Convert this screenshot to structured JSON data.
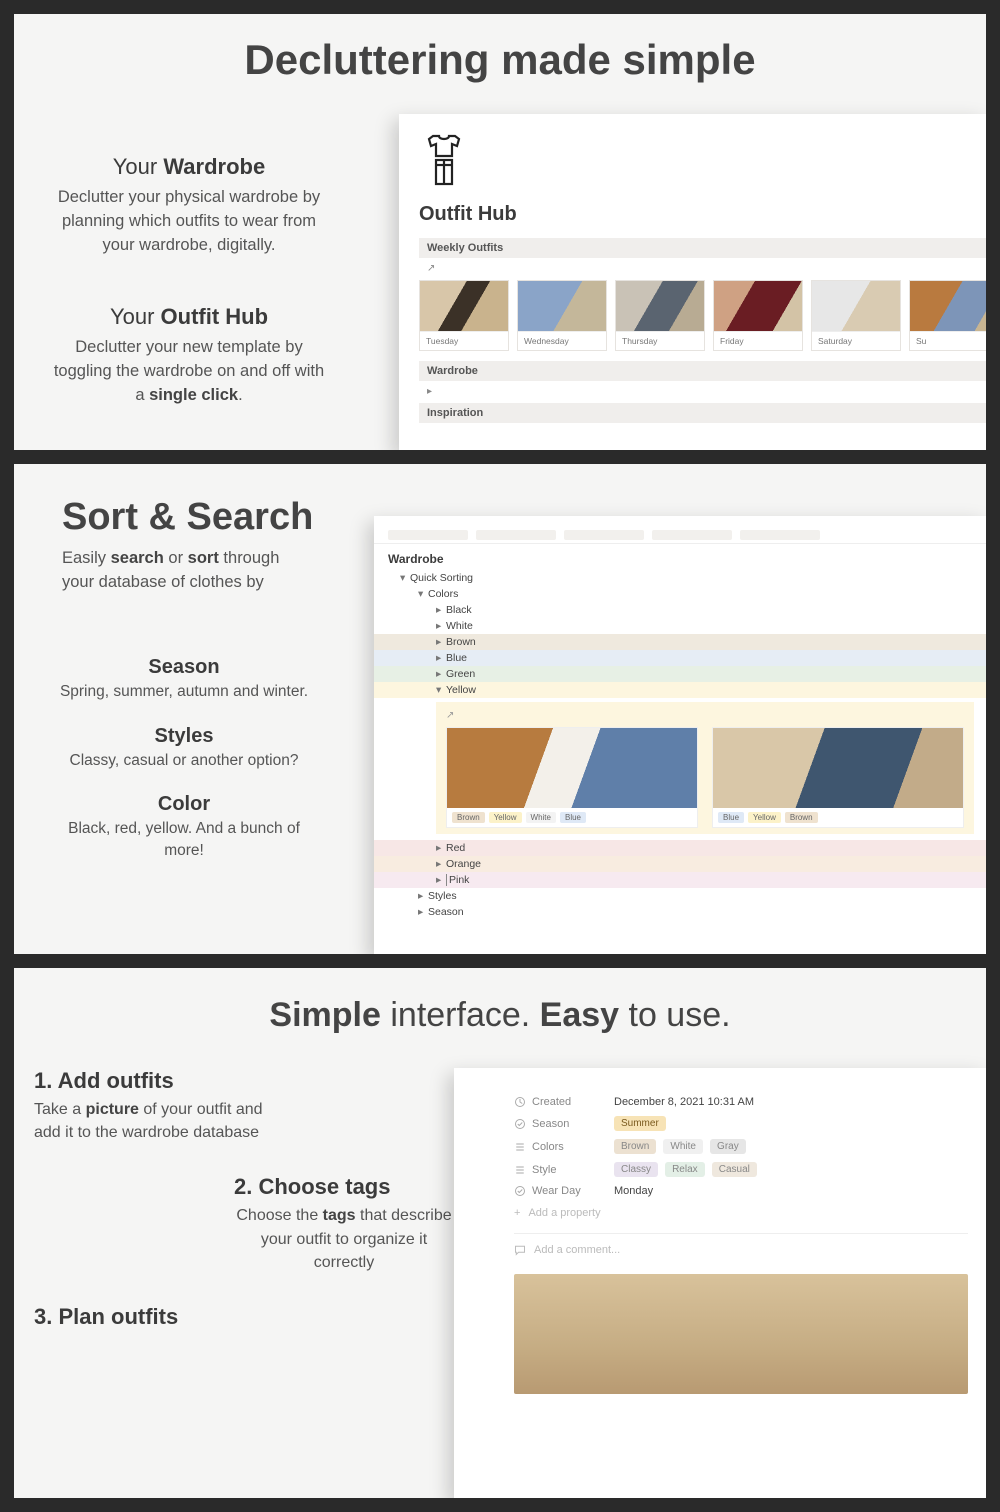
{
  "panel1": {
    "title": "Decluttering made simple",
    "block1": {
      "prefix": "Your ",
      "bold": "Wardrobe",
      "body": "Declutter your physical wardrobe by planning which outfits to wear from your wardrobe, digitally."
    },
    "block2": {
      "prefix": "Your ",
      "bold": "Outfit Hub",
      "body_a": "Declutter your new template by toggling the wardrobe on and off with a ",
      "body_b": "single click",
      "body_c": "."
    },
    "app": {
      "title": "Outfit Hub",
      "sec_weekly": "Weekly Outfits",
      "days": [
        "Tuesday",
        "Wednesday",
        "Thursday",
        "Friday",
        "Saturday",
        "Su"
      ],
      "sec_wardrobe": "Wardrobe",
      "sec_inspiration": "Inspiration"
    }
  },
  "panel2": {
    "title": "Sort & Search",
    "lead_a": "Easily ",
    "lead_b": "search",
    "lead_c": " or ",
    "lead_d": "sort",
    "lead_e": " through your database of clothes by",
    "cats": [
      {
        "h": "Season",
        "p": "Spring, summer, autumn and winter."
      },
      {
        "h": "Styles",
        "p": "Classy, casual or another option?"
      },
      {
        "h": "Color",
        "p": "Black, red, yellow. And a bunch of more!"
      }
    ],
    "app": {
      "wardrobe": "Wardrobe",
      "quick": "Quick Sorting",
      "colors_label": "Colors",
      "colors": [
        "Black",
        "White",
        "Brown",
        "Blue",
        "Green",
        "Yellow"
      ],
      "card1_tags": [
        "Brown",
        "Yellow",
        "White",
        "Blue"
      ],
      "card2_tags": [
        "Blue",
        "Yellow",
        "Brown"
      ],
      "more_colors": [
        "Red",
        "Orange",
        "Pink"
      ],
      "styles": "Styles",
      "season": "Season"
    }
  },
  "panel3": {
    "title_parts": [
      "Simple",
      " interface. ",
      "Easy",
      " to use."
    ],
    "steps": [
      {
        "h": "1. Add outfits",
        "p_a": "Take a ",
        "p_b": "picture",
        "p_c": " of your outfit and add it to the wardrobe database"
      },
      {
        "h": "2. Choose tags",
        "p_a": "Choose the ",
        "p_b": "tags",
        "p_c": " that describe your outfit to organize it correctly"
      },
      {
        "h": "3. Plan outfits",
        "p_a": "",
        "p_b": "",
        "p_c": ""
      }
    ],
    "app": {
      "props": {
        "created_l": "Created",
        "created_v": "December 8, 2021 10:31 AM",
        "season_l": "Season",
        "season_v": "Summer",
        "colors_l": "Colors",
        "colors_v": [
          "Brown",
          "White",
          "Gray"
        ],
        "style_l": "Style",
        "style_v": [
          "Classy",
          "Relax",
          "Casual"
        ],
        "wearday_l": "Wear Day",
        "wearday_v": "Monday",
        "add_prop": "Add a property",
        "add_comment": "Add a comment..."
      }
    }
  }
}
